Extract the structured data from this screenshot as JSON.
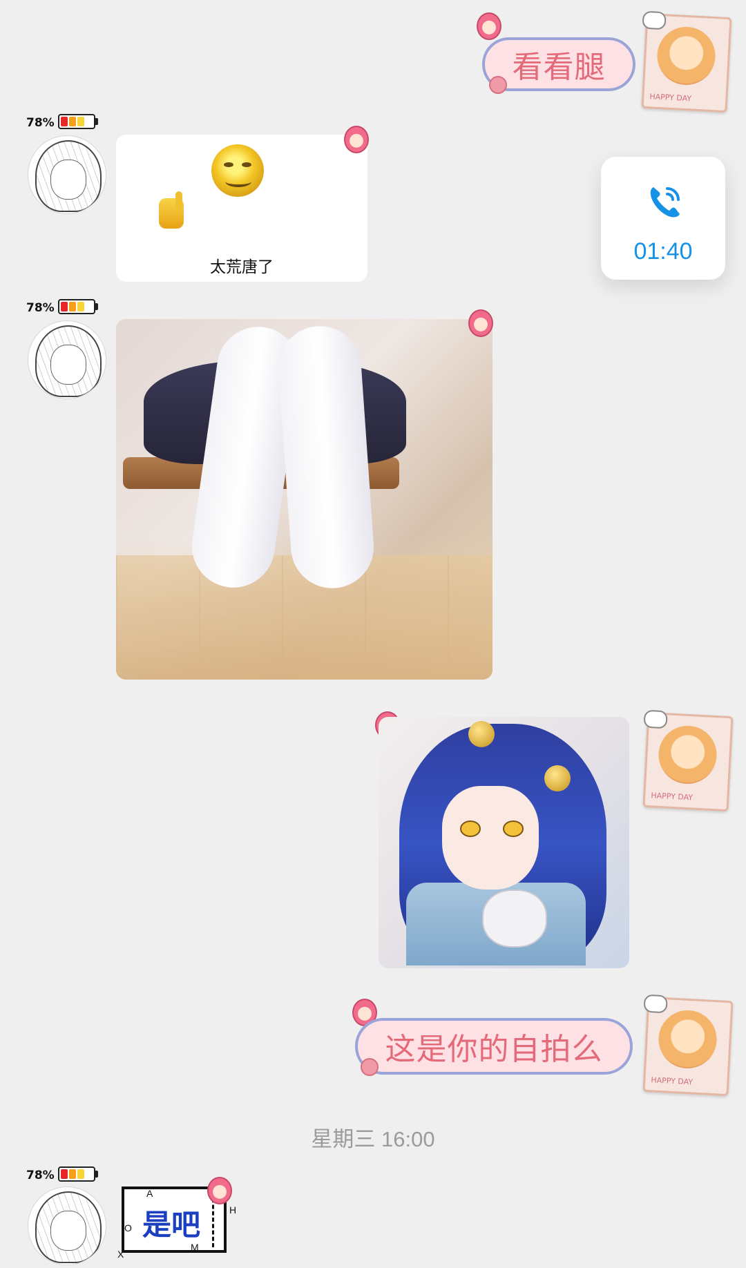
{
  "messages": {
    "outgoing_1": {
      "text": "看看腿"
    },
    "incoming_meme": {
      "caption": "太荒唐了"
    },
    "call": {
      "duration": "01:40",
      "icon": "phone-icon",
      "accent": "#1591e8"
    },
    "outgoing_2": {
      "text": "这是你的自拍么"
    },
    "timestamp": "星期三 16:00",
    "incoming_last": {
      "text": "是吧"
    }
  },
  "contact": {
    "battery_pct": "78%",
    "battery_colors": [
      "#e8262a",
      "#f6a01a",
      "#f8d43b"
    ]
  },
  "self": {
    "frame_caption": "HAPPY DAY"
  },
  "sticker_axis_labels": {
    "a": "A",
    "h": "H",
    "o": "O",
    "x": "X",
    "m": "M"
  },
  "colors": {
    "background": "#efefef",
    "bubble_fill": "#fde1e4",
    "bubble_border": "#9aa4d8",
    "bubble_text": "#e46a7a"
  }
}
